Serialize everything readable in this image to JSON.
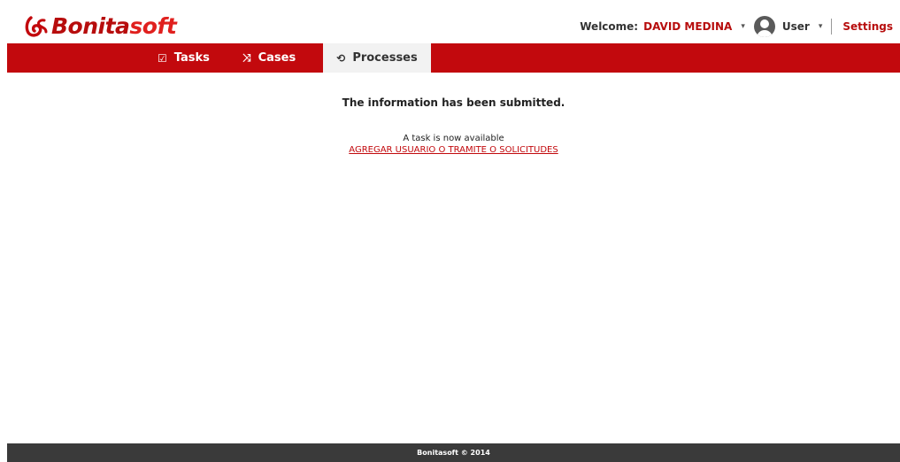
{
  "header": {
    "logo": {
      "text_part1": "Bonita",
      "text_part2": "soft",
      "mark_icon": "bonita-swirl-icon"
    },
    "welcome_label": "Welcome:",
    "user_name": "DAVID MEDINA",
    "user_menu_label": "User",
    "settings_label": "Settings",
    "dropdown_icon": "▾"
  },
  "nav": {
    "tabs": [
      {
        "label": "Tasks",
        "icon": "☑"
      },
      {
        "label": "Cases",
        "icon": "⤨"
      },
      {
        "label": "Processes",
        "icon": "⟲",
        "active": true
      }
    ]
  },
  "main": {
    "message": "The information has been submitted.",
    "sub_message": "A task is now available",
    "task_link": "AGREGAR USUARIO O TRAMITE O SOLICITUDES"
  },
  "footer": {
    "text": "Bonitasoft © 2014"
  },
  "colors": {
    "brand_red": "#c2090d",
    "footer_bg": "#3a3a3a"
  }
}
